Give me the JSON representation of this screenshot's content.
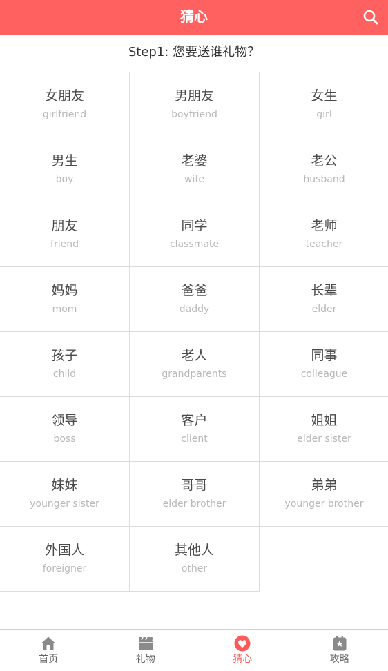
{
  "header": {
    "title": "猜心",
    "search_icon": "search-icon"
  },
  "step": {
    "text": "Step1: 您要送谁礼物？"
  },
  "recipients": [
    {
      "zh": "女朋友",
      "en": "girlfriend"
    },
    {
      "zh": "男朋友",
      "en": "boyfriend"
    },
    {
      "zh": "女生",
      "en": "girl"
    },
    {
      "zh": "男生",
      "en": "boy"
    },
    {
      "zh": "老婆",
      "en": "wife"
    },
    {
      "zh": "老公",
      "en": "husband"
    },
    {
      "zh": "朋友",
      "en": "friend"
    },
    {
      "zh": "同学",
      "en": "classmate"
    },
    {
      "zh": "老师",
      "en": "teacher"
    },
    {
      "zh": "妈妈",
      "en": "mom"
    },
    {
      "zh": "爸爸",
      "en": "daddy"
    },
    {
      "zh": "长辈",
      "en": "elder"
    },
    {
      "zh": "孩子",
      "en": "child"
    },
    {
      "zh": "老人",
      "en": "grandparents"
    },
    {
      "zh": "同事",
      "en": "colleague"
    },
    {
      "zh": "领导",
      "en": "boss"
    },
    {
      "zh": "客户",
      "en": "client"
    },
    {
      "zh": "姐姐",
      "en": "elder sister"
    },
    {
      "zh": "妹妹",
      "en": "younger sister"
    },
    {
      "zh": "哥哥",
      "en": "elder brother"
    },
    {
      "zh": "弟弟",
      "en": "younger brother"
    },
    {
      "zh": "外国人",
      "en": "foreigner"
    },
    {
      "zh": "其他人",
      "en": "other"
    }
  ],
  "tabs": [
    {
      "label": "首页",
      "icon": "home-icon",
      "active": false
    },
    {
      "label": "礼物",
      "icon": "gift-icon",
      "active": false
    },
    {
      "label": "猜心",
      "icon": "heart-icon",
      "active": true
    },
    {
      "label": "攻略",
      "icon": "guide-star-icon",
      "active": false
    }
  ],
  "colors": {
    "accent": "#ff6161",
    "active_tab": "#ff5a5a",
    "inactive_icon": "#8a8a8a",
    "text_primary": "#4a4a4a",
    "text_secondary": "#b8b8b8",
    "divider": "#dcdcdc"
  }
}
